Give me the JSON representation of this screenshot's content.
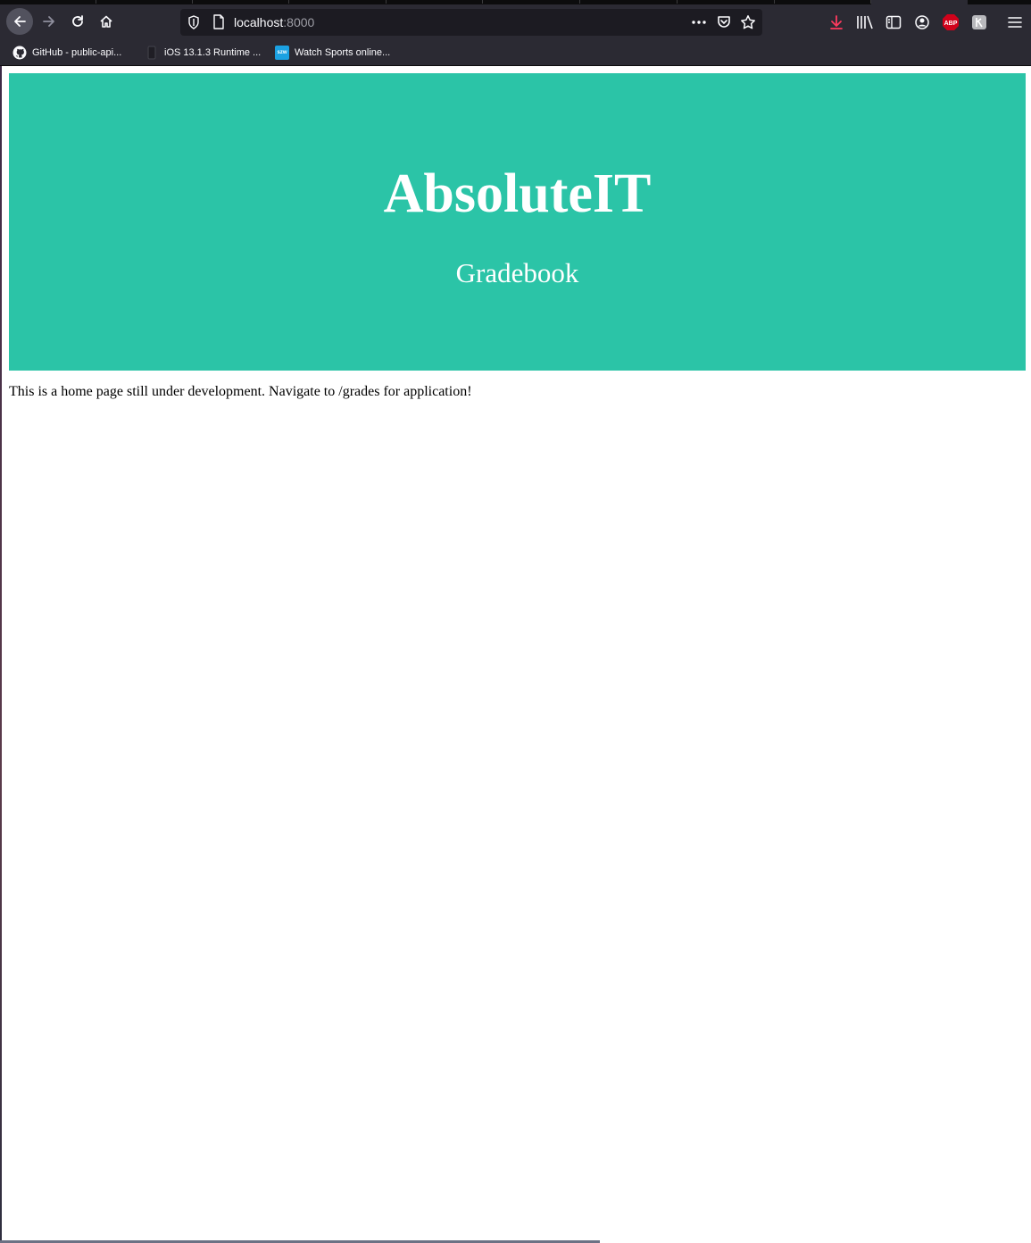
{
  "browser": {
    "url_host": "localhost",
    "url_port": ":8000",
    "bookmarks": [
      {
        "label": "GitHub - public-api...",
        "icon": "github-icon"
      },
      {
        "label": "iOS 13.1.3 Runtime ...",
        "icon": "phone-icon"
      },
      {
        "label": "Watch Sports online...",
        "icon": "sz-icon",
        "icon_text": "szw"
      }
    ],
    "toolbar_icons": [
      "download-icon",
      "library-icon",
      "sidebar-icon",
      "account-icon",
      "adblock-icon",
      "extension-icon",
      "menu-icon"
    ],
    "adblock_label": "ABP"
  },
  "page": {
    "hero_title": "AbsoluteIT",
    "hero_subtitle": "Gradebook",
    "hero_color": "#2bc4a7",
    "intro_text": "This is a home page still under development. Navigate to /grades for application!"
  }
}
